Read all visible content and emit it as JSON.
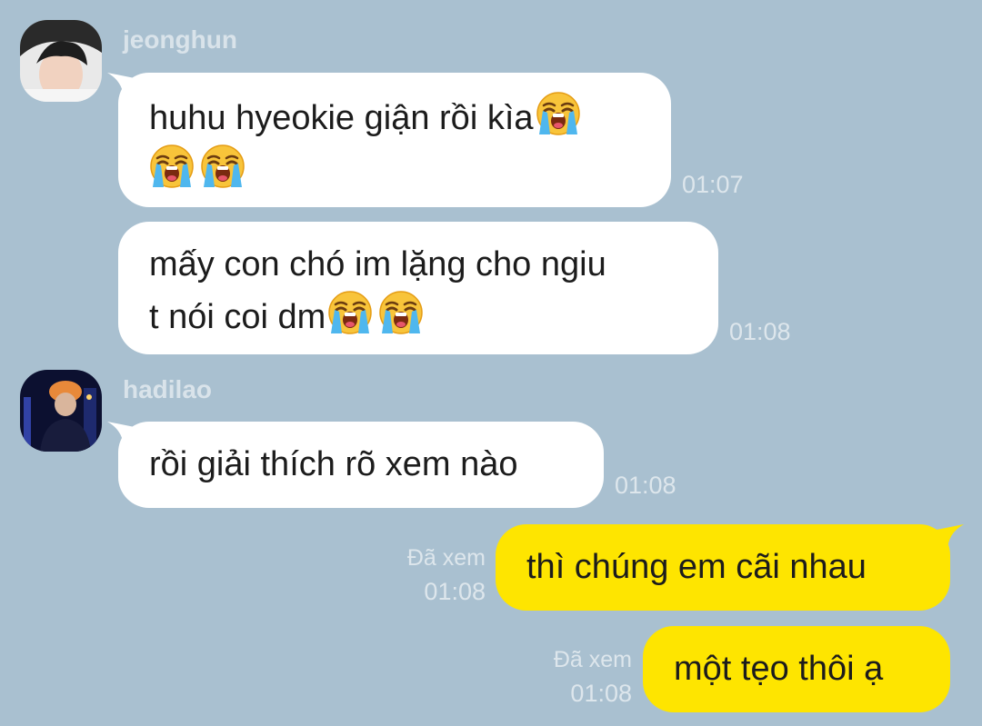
{
  "colors": {
    "background": "#a9c0d0",
    "incoming_bubble": "#ffffff",
    "outgoing_bubble": "#fee500",
    "meta_text": "#dde6ec"
  },
  "messages": [
    {
      "sender": "jeonghun",
      "direction": "in",
      "lines": [
        "huhu hyeokie giận rồi kìa",
        ""
      ],
      "emojis": [
        "loudly-crying-face-icon",
        "loudly-crying-face-icon",
        "loudly-crying-face-icon"
      ],
      "time": "01:07"
    },
    {
      "sender": "jeonghun",
      "direction": "in",
      "lines": [
        "mấy con chó im lặng cho ngiu",
        "t nói coi dm"
      ],
      "emojis": [
        "loudly-crying-face-icon",
        "loudly-crying-face-icon"
      ],
      "time": "01:08"
    },
    {
      "sender": "hadilao",
      "direction": "in",
      "text": "rồi giải thích rõ xem nào",
      "time": "01:08"
    },
    {
      "direction": "out",
      "text": "thì chúng em cãi nhau",
      "read_status": "Đã xem",
      "time": "01:08"
    },
    {
      "direction": "out",
      "text": "một tẹo thôi ạ",
      "read_status": "Đã xem",
      "time": "01:08"
    }
  ]
}
